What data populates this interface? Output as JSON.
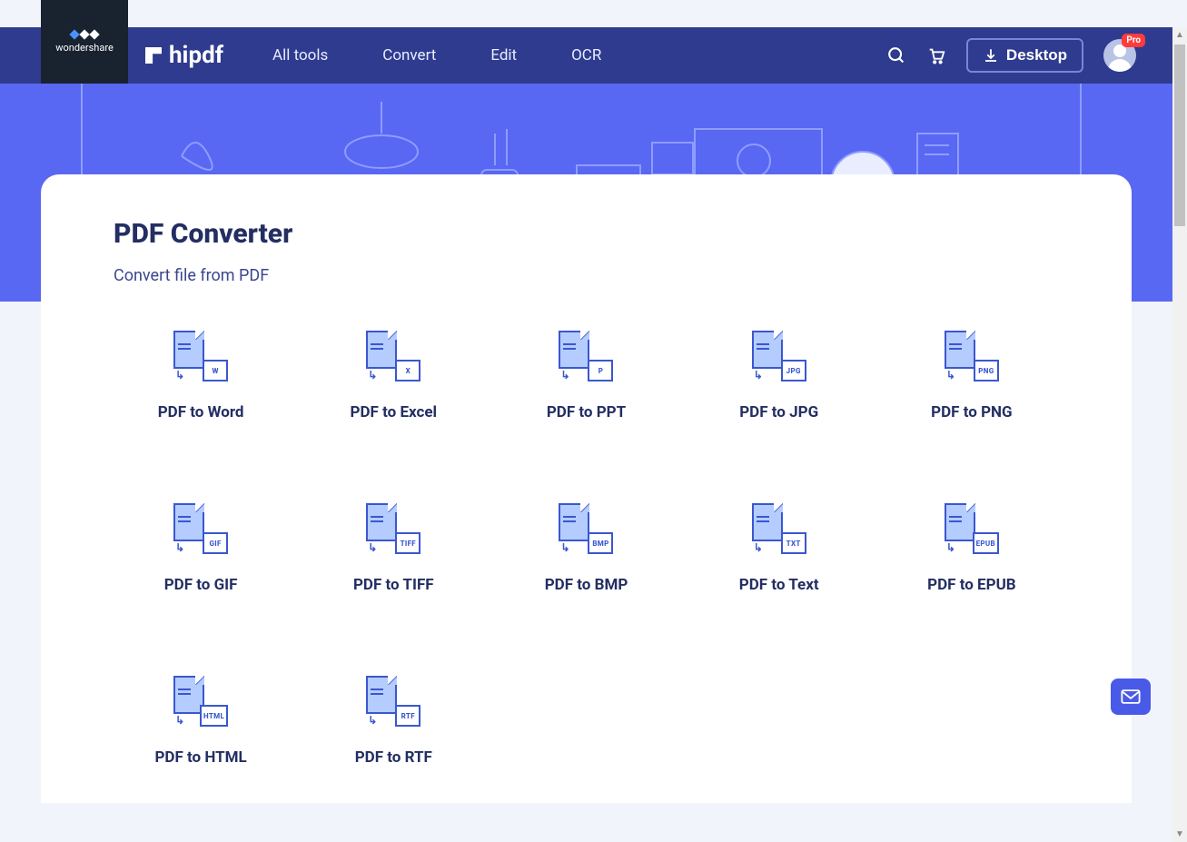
{
  "brand": {
    "wondershare": "wondershare",
    "logo_text": "hipdf"
  },
  "nav": {
    "items": [
      {
        "label": "All tools"
      },
      {
        "label": "Convert"
      },
      {
        "label": "Edit"
      },
      {
        "label": "OCR"
      }
    ],
    "desktop_label": "Desktop",
    "user_badge": "Pro"
  },
  "page": {
    "title": "PDF Converter",
    "subtitle": "Convert file from PDF"
  },
  "tools": [
    {
      "label": "PDF to Word",
      "tag": "W"
    },
    {
      "label": "PDF to Excel",
      "tag": "X"
    },
    {
      "label": "PDF to PPT",
      "tag": "P"
    },
    {
      "label": "PDF to JPG",
      "tag": "JPG"
    },
    {
      "label": "PDF to PNG",
      "tag": "PNG"
    },
    {
      "label": "PDF to GIF",
      "tag": "GIF"
    },
    {
      "label": "PDF to TIFF",
      "tag": "TIFF"
    },
    {
      "label": "PDF to BMP",
      "tag": "BMP"
    },
    {
      "label": "PDF to Text",
      "tag": "TXT"
    },
    {
      "label": "PDF to EPUB",
      "tag": "EPUB"
    },
    {
      "label": "PDF to HTML",
      "tag": "HTML"
    },
    {
      "label": "PDF to RTF",
      "tag": "RTF"
    }
  ],
  "colors": {
    "primary": "#2f3b8e",
    "accent": "#5868f3",
    "text": "#232e63"
  }
}
